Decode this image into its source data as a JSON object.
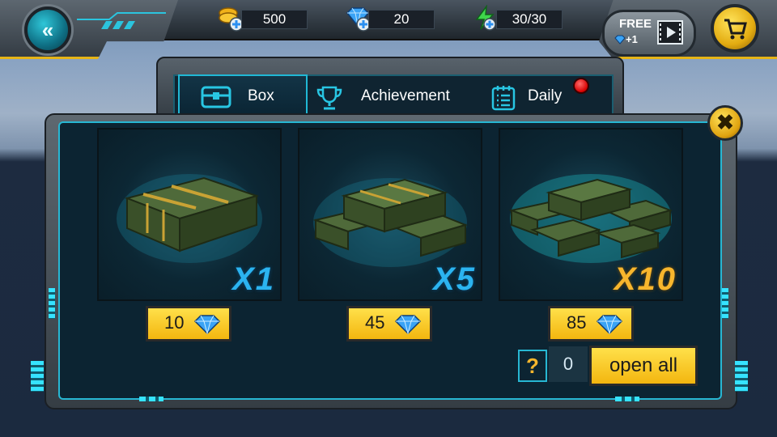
{
  "hud": {
    "gold": "500",
    "gems": "20",
    "energy": "30/30",
    "free_label": "FREE",
    "free_reward": "+1"
  },
  "tabs": [
    {
      "label": "Box",
      "icon": "chest-icon",
      "active": true
    },
    {
      "label": "Achievement",
      "icon": "trophy-icon",
      "active": false
    },
    {
      "label": "Daily",
      "icon": "calendar-icon",
      "active": false
    }
  ],
  "boxes": [
    {
      "multiplier": "X1",
      "price": "10",
      "color": "#2bb4f0"
    },
    {
      "multiplier": "X5",
      "price": "45",
      "color": "#2bb4f0"
    },
    {
      "multiplier": "X10",
      "price": "85",
      "color": "#f7b62d"
    }
  ],
  "footer": {
    "help": "?",
    "count": "0",
    "open_all_label": "open all"
  },
  "colors": {
    "accent_cyan": "#27b7d3",
    "button_gold": "#f3b60f",
    "gem_blue": "#2b8ff0"
  }
}
